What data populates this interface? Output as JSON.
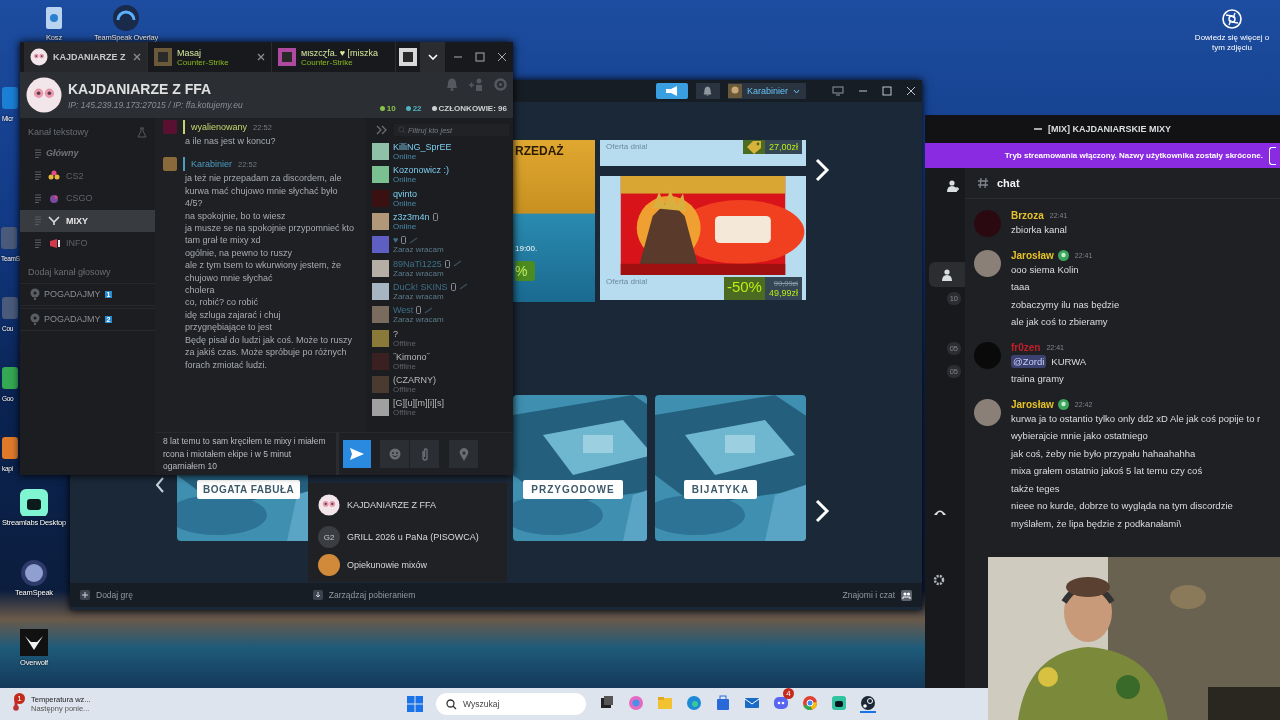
{
  "desktop": {
    "icons": [
      {
        "label": "Kosz",
        "kind": "bin"
      },
      {
        "label": "TeamSpeak Overlay",
        "kind": "headset"
      },
      {
        "label": "Micr",
        "kind": "edge"
      },
      {
        "label": "TeamS"
      },
      {
        "label": "Cou"
      },
      {
        "label": "Goo",
        "kind": "green"
      },
      {
        "label": "kapi",
        "kind": "orange"
      },
      {
        "label": "Streamlabs Desktop",
        "kind": "streamlabs"
      },
      {
        "label": "TeamSpeak",
        "kind": "teamspeak"
      },
      {
        "label": "Overwolf",
        "kind": "wolf"
      }
    ],
    "photo_info": "Dowiedz się więcej o tym zdjęciu"
  },
  "teamspeak": {
    "tabs": [
      {
        "title": "KAJDANIARZE Z",
        "selected": true,
        "closable": true
      },
      {
        "title": "Masaj",
        "subtitle": "Counter-Strike",
        "selected": false,
        "closable": true
      },
      {
        "title": "мιszcɀfa. ♥ [miszka",
        "subtitle": "Counter-Strike",
        "selected": false,
        "closable": false
      },
      {
        "selected": false,
        "closable": false
      }
    ],
    "server": {
      "name": "KAJDANIARZE Z FFA",
      "address": "IP: 145.239.19.173:27015 / IP: ffa.kotujemy.eu"
    },
    "stats": [
      {
        "text": "10",
        "color": "#8bc34a"
      },
      {
        "text": "22",
        "color": "#4fb3bf"
      },
      {
        "text": "CZŁONKOWIE: 96",
        "color": "#d0d0d0"
      }
    ],
    "text_heading": "Kanał tekstowy",
    "text_channels": [
      {
        "name": "Główny",
        "default": true,
        "selected": false,
        "kind": "plain"
      },
      {
        "name": "CS2",
        "default": false,
        "selected": false,
        "kind": "cs2"
      },
      {
        "name": "CSGO",
        "default": false,
        "selected": false,
        "kind": "csgo"
      },
      {
        "name": "MIXY",
        "default": false,
        "selected": true,
        "kind": "mixy"
      },
      {
        "name": "INFO",
        "default": false,
        "selected": false,
        "kind": "info"
      }
    ],
    "voice_heading": "Dodaj kanał głosowy",
    "voice_channels": [
      {
        "name": "POGADAJMY",
        "badge": "1"
      },
      {
        "name": "POGADAJMY",
        "badge": "2"
      }
    ],
    "messages": [
      {
        "author": "wyalienowany",
        "time": "22:52",
        "color": "#c6d46e",
        "lines": [
          "a ile nas jest w koncu?"
        ]
      },
      {
        "author": "Karabinier",
        "time": "22:52",
        "color": "#4b9cc2",
        "lines": [
          "ja też nie przepadam za discordem, ale kurwa mać chujowo mnie słychać było",
          "4/5?",
          "na spokojnie, bo to wiesz",
          "ja musze se na spokojnie przypomnieć kto tam grał te mixy xd",
          "ogólnie, na pewno to ruszy",
          "ale z tym tsem to wkurwiony jestem, że chujowo mnie słychać",
          "cholera",
          "co, robić? co robić",
          "idę szluga zajarać i chuj",
          "przygnębiające to jest",
          "Będę pisał do ludzi jak coś. Może to ruszy za jakiś czas. Może spróbuje po różnych forach zmiotać ludzi."
        ]
      }
    ],
    "filter_placeholder": "Filtruj kto jest",
    "members": [
      {
        "name": "KilliNG_SprEE",
        "status": "Online",
        "kind": "online",
        "mobile": false
      },
      {
        "name": "Kozonowicz :)",
        "status": "Online",
        "kind": "online",
        "mobile": false
      },
      {
        "name": "qvinto",
        "status": "Online",
        "kind": "online",
        "mobile": false
      },
      {
        "name": "z3z3m4n",
        "status": "Online",
        "kind": "online",
        "mobile": true
      },
      {
        "name": "♥",
        "status": "Zaraz wracam",
        "kind": "away",
        "mobile": true
      },
      {
        "name": "89NaTi1225",
        "status": "Zaraz wracam",
        "kind": "away",
        "mobile": true
      },
      {
        "name": "DuCk! SKINS",
        "status": "Zaraz wracam",
        "kind": "away",
        "mobile": true
      },
      {
        "name": "West",
        "status": "Zaraz wracam",
        "kind": "away",
        "mobile": true
      },
      {
        "name": "?",
        "status": "Offline",
        "kind": "offline",
        "mobile": false
      },
      {
        "name": "˝Kimono˝",
        "status": "Offline",
        "kind": "offline",
        "mobile": false
      },
      {
        "name": "(CZARNY)",
        "status": "Offline",
        "kind": "offline",
        "mobile": false
      },
      {
        "name": "[G][u][m][i][s]",
        "status": "Offline",
        "kind": "offline",
        "mobile": false
      }
    ],
    "composer": "8 lat temu to sam kręciłem te mixy i miałem rcona i miotałem ekipe i w 5 minut ogarniałem 10"
  },
  "server_list": [
    {
      "name": "KAJDANIARZE Z FFA",
      "kind": "logo"
    },
    {
      "name": "GRILL 2026 u PaNa (PISOWCA)",
      "initials": "G2",
      "kind": "initials"
    },
    {
      "name": "Opiekunowie mixów",
      "kind": "avatar"
    }
  ],
  "steam": {
    "user": "Karabinier",
    "sale_tile": {
      "title": "RZEDAŻ",
      "time": "19:00.",
      "badge": "%"
    },
    "offers": [
      {
        "label": "Oferta dnia!",
        "price": "27,00zł",
        "kind": "tag"
      },
      {
        "label": "Oferta dnia!",
        "discount": "-50%",
        "old_price": "99,99zł",
        "price": "49,99zł",
        "kind": "picture"
      }
    ],
    "categories": [
      "BOGATA FABUŁA",
      "PRZYGODOWE",
      "BIJATYKA"
    ],
    "footer": {
      "add_game": "Dodaj grę",
      "downloads": "Zarządzaj pobieraniem",
      "friends": "Znajomi i czat"
    }
  },
  "discord": {
    "title": "[MIX] KAJDANIARSKIE MIXY",
    "banner": "Tryb streamowania włączony. Nazwy użytkownika zostały skrócone.",
    "channel": "chat",
    "side_badges": [
      "10",
      "05",
      "05"
    ],
    "messages": [
      {
        "author": "Brzoza",
        "time": "22:41",
        "color": "#e6c229",
        "badge": false,
        "lines": [
          "zbiorka kanal"
        ]
      },
      {
        "author": "Jarosław",
        "time": "22:41",
        "color": "#e6c229",
        "badge": true,
        "lines": [
          "ooo siema Kolin",
          "taaa",
          "zobaczymy ilu nas będzie",
          "ale jak coś to zbieramy"
        ]
      },
      {
        "author": "fr0zen",
        "time": "22:41",
        "color": "#c0202a",
        "badge": false,
        "mention": "@Zordi",
        "lines": [
          "KURWA",
          "traina gramy"
        ]
      },
      {
        "author": "Jarosław",
        "time": "22:42",
        "color": "#e6c229",
        "badge": true,
        "lines": [
          "kurwa ja to ostantio tylko only dd2 xD Ale jak coś popije to r",
          "wybierajcie mnie jako ostatniego",
          "jak coś, żeby nie było przypału hahaahahha",
          "mixa grałem ostatnio jakoś 5 lat temu czy coś",
          "także teges",
          "nieee no kurde, dobrze to wygląda na tym discordzie",
          "myślałem, że lipa będzie z podkanałami\\"
        ]
      }
    ]
  },
  "taskbar": {
    "notice": {
      "title": "Temperatura wz...",
      "subtitle": "Następny ponie...",
      "count": "1"
    },
    "search": {
      "placeholder": "Wyszukaj"
    },
    "discord_count": "4"
  }
}
